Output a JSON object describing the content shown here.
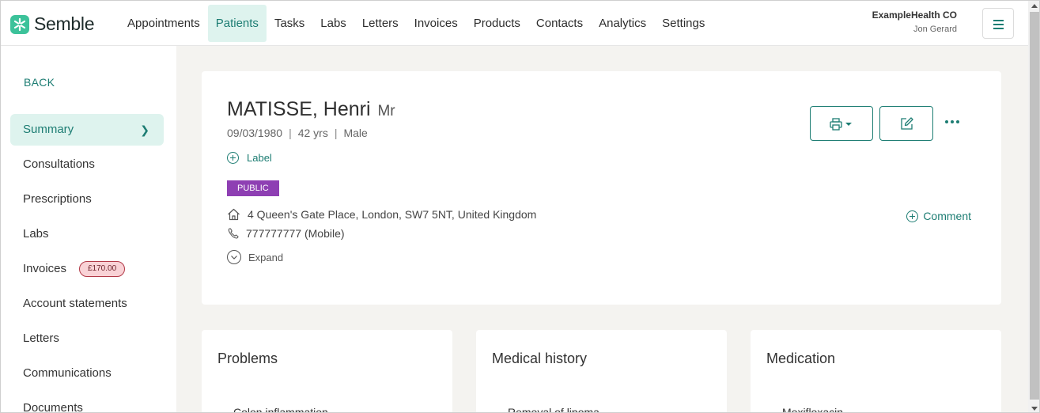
{
  "brand": {
    "name": "Semble",
    "accent": "#1d7d73",
    "logo_color": "#3cc29a"
  },
  "nav": {
    "items": [
      "Appointments",
      "Patients",
      "Tasks",
      "Labs",
      "Letters",
      "Invoices",
      "Products",
      "Contacts",
      "Analytics",
      "Settings"
    ],
    "active": "Patients"
  },
  "org": {
    "name": "ExampleHealth CO",
    "user": "Jon Gerard"
  },
  "sidebar": {
    "back_label": "BACK",
    "items": [
      {
        "label": "Summary",
        "active": true
      },
      {
        "label": "Consultations"
      },
      {
        "label": "Prescriptions"
      },
      {
        "label": "Labs"
      },
      {
        "label": "Invoices",
        "badge": "£170.00"
      },
      {
        "label": "Account statements"
      },
      {
        "label": "Letters"
      },
      {
        "label": "Communications"
      },
      {
        "label": "Documents"
      }
    ]
  },
  "patient": {
    "surname_first": "MATISSE, Henri",
    "title": "Mr",
    "dob": "09/03/1980",
    "age": "42 yrs",
    "gender": "Male",
    "add_label": "Label",
    "visibility_badge": "PUBLIC",
    "address": "4 Queen's Gate Place, London, SW7 5NT, United Kingdom",
    "phone": "777777777 (Mobile)",
    "expand_label": "Expand",
    "comment_label": "Comment"
  },
  "panels": [
    {
      "title": "Problems",
      "first_item": "Colon inflammation"
    },
    {
      "title": "Medical history",
      "first_item": "Removal of lipoma"
    },
    {
      "title": "Medication",
      "first_item": "Moxifloxacin"
    }
  ],
  "icons": {
    "print": "printer-icon",
    "edit": "edit-icon",
    "more": "more-horizontal-icon",
    "home": "home-icon",
    "phone": "phone-icon",
    "expand": "chevron-down-circle-icon",
    "add": "plus-circle-icon",
    "menu": "hamburger-icon"
  }
}
